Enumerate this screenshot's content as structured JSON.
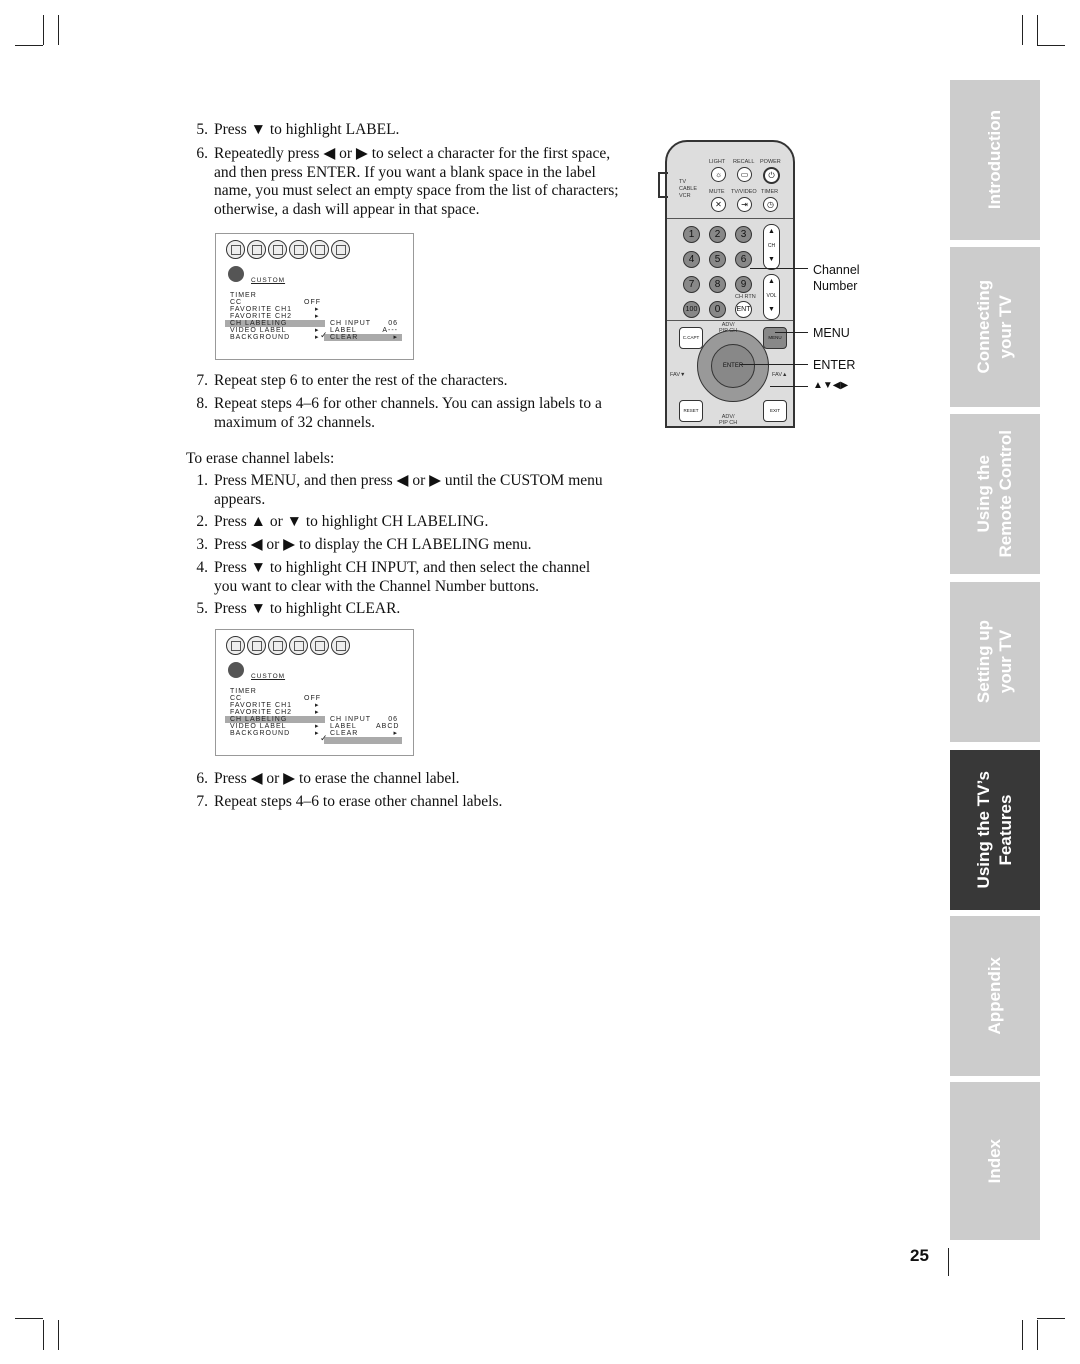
{
  "steps_a": [
    {
      "n": "5.",
      "lines": [
        "Press ▼ to highlight LABEL."
      ]
    },
    {
      "n": "6.",
      "lines": [
        "Repeatedly press ◀ or ▶ to select a character for the first space,",
        "and then press ENTER. If you want a blank space in the label",
        "name, you must select an empty space from the list of characters;",
        "otherwise, a dash will appear in that space."
      ]
    },
    {
      "n": "7.",
      "lines": [
        "Repeat step 6 to enter the rest of the characters."
      ]
    },
    {
      "n": "8.",
      "lines": [
        "Repeat steps 4–6 for other channels. You can assign labels to a",
        "maximum of 32 channels."
      ]
    }
  ],
  "erase_heading": "To erase channel labels:",
  "steps_b": [
    {
      "n": "1.",
      "lines": [
        "Press MENU, and then press ◀ or ▶ until the CUSTOM menu",
        "appears."
      ]
    },
    {
      "n": "2.",
      "lines": [
        "Press ▲ or ▼ to highlight CH LABELING."
      ]
    },
    {
      "n": "3.",
      "lines": [
        "Press ◀ or ▶ to display the CH LABELING menu."
      ]
    },
    {
      "n": "4.",
      "lines": [
        "Press ▼ to highlight CH INPUT, and then select the channel",
        "you want to clear with the Channel Number buttons."
      ]
    },
    {
      "n": "5.",
      "lines": [
        "Press ▼ to highlight CLEAR."
      ]
    },
    {
      "n": "6.",
      "lines": [
        "Press ◀ or ▶ to erase the channel label."
      ]
    },
    {
      "n": "7.",
      "lines": [
        "Repeat steps 4–6 to erase other channel labels."
      ]
    }
  ],
  "menu1": {
    "title": "CUSTOM",
    "items": [
      "TIMER",
      "CC",
      "FAVORITE CH1",
      "FAVORITE CH2",
      "CH LABELING",
      "VIDEO LABEL",
      "BACKGROUND"
    ],
    "cc_value": "OFF",
    "sub": [
      {
        "label": "CH INPUT",
        "value": "06"
      },
      {
        "label": "LABEL",
        "value": "A---"
      },
      {
        "label": "CLEAR",
        "value": "▸"
      }
    ],
    "highlighted_sub": "LABEL"
  },
  "menu2": {
    "title": "CUSTOM",
    "items": [
      "TIMER",
      "CC",
      "FAVORITE CH1",
      "FAVORITE CH2",
      "CH LABELING",
      "VIDEO LABEL",
      "BACKGROUND"
    ],
    "cc_value": "OFF",
    "sub": [
      {
        "label": "CH INPUT",
        "value": "06"
      },
      {
        "label": "LABEL",
        "value": "ABCD"
      },
      {
        "label": "CLEAR",
        "value": "▸"
      }
    ],
    "highlighted_sub": "CLEAR"
  },
  "remote": {
    "top_labels": [
      "LIGHT",
      "RECALL",
      "POWER",
      "MUTE",
      "TV/VIDEO",
      "TIMER"
    ],
    "switch": [
      "TV",
      "CABLE",
      "VCR"
    ],
    "digits": [
      "1",
      "2",
      "3",
      "4",
      "5",
      "6",
      "7",
      "8",
      "9",
      "100",
      "0",
      "ENT"
    ],
    "ch": "CH",
    "vol": "VOL",
    "chrtn": "CH RTN",
    "adv_top": "ADV/\nPIP CH",
    "adv_bottom": "ADV/\nPIP CH",
    "enter": "ENTER",
    "fav_left": "FAV▼",
    "fav_right": "FAV▲",
    "c_capt": "C.CAPT",
    "menu": "MENU",
    "reset": "RESET",
    "exit": "EXIT"
  },
  "callouts": {
    "channel": "Channel",
    "number": "Number",
    "menu": "MENU",
    "enter": "ENTER",
    "arrows": "▲▼◀▶"
  },
  "tabs": [
    {
      "lines": [
        "Introduction"
      ],
      "active": false
    },
    {
      "lines": [
        "Connecting",
        "your TV"
      ],
      "active": false
    },
    {
      "lines": [
        "Using the",
        "Remote Control"
      ],
      "active": false
    },
    {
      "lines": [
        "Setting up",
        "your TV"
      ],
      "active": false
    },
    {
      "lines": [
        "Using the TV’s",
        "Features"
      ],
      "active": true
    },
    {
      "lines": [
        "Appendix"
      ],
      "active": false
    },
    {
      "lines": [
        "Index"
      ],
      "active": false
    }
  ],
  "page_number": "25",
  "colors": {
    "tab": "#cccccc",
    "tab_active": "#383838",
    "highlight": "#aaaaaa"
  }
}
